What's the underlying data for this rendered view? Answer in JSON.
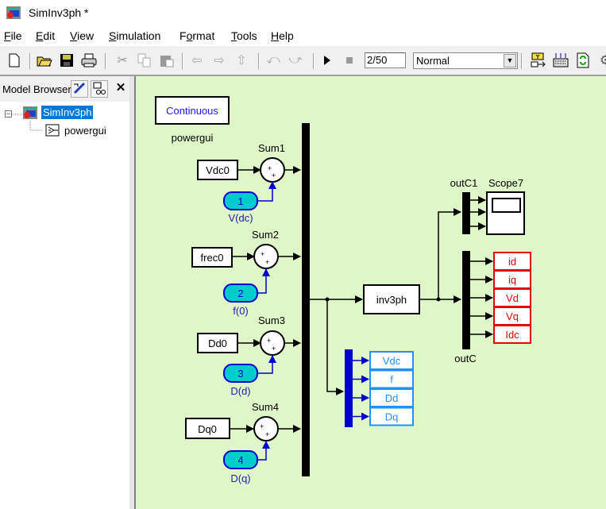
{
  "window": {
    "title": "SimInv3ph *",
    "app_icon": "simulink-model-icon"
  },
  "menu": {
    "items": [
      {
        "label": "File",
        "accel": "F"
      },
      {
        "label": "Edit",
        "accel": "E"
      },
      {
        "label": "View",
        "accel": "V"
      },
      {
        "label": "Simulation",
        "accel": "S"
      },
      {
        "label": "Format",
        "accel": "o"
      },
      {
        "label": "Tools",
        "accel": "T"
      },
      {
        "label": "Help",
        "accel": "H"
      }
    ]
  },
  "toolbar": {
    "buttons": [
      "new-icon",
      "open-icon",
      "save-icon",
      "print-icon",
      "cut-icon",
      "copy-icon",
      "paste-icon",
      "back-icon",
      "forward-icon",
      "up-icon",
      "undo-icon",
      "redo-icon",
      "run-icon",
      "stop-icon"
    ],
    "stop_time": "2/50",
    "sim_mode": "Normal",
    "right_buttons": [
      "library-browser-icon",
      "model-explorer-icon",
      "update-diagram-icon",
      "debug-icon"
    ]
  },
  "model_browser": {
    "title": "Model Browser",
    "buttons": [
      "show-library-links-icon",
      "show-masked-subsystems-icon",
      "close-icon"
    ],
    "tree": {
      "root": "SimInv3ph",
      "children": [
        "powergui"
      ]
    }
  },
  "diagram": {
    "powergui": {
      "mode": "Continuous",
      "name": "powergui"
    },
    "sums": [
      {
        "name": "Sum1",
        "const": "Vdc0",
        "inport_num": "1",
        "inport_name": "V(dc)"
      },
      {
        "name": "Sum2",
        "const": "frec0",
        "inport_num": "2",
        "inport_name": "f(0)"
      },
      {
        "name": "Sum3",
        "const": "Dd0",
        "inport_num": "3",
        "inport_name": "D(d)"
      },
      {
        "name": "Sum4",
        "const": "Dq0",
        "inport_num": "4",
        "inport_name": "D(q)"
      }
    ],
    "subsystem": "inv3ph",
    "demux_top": "outC1",
    "scope": "Scope7",
    "demux_out": "outC",
    "outports": [
      "id",
      "iq",
      "Vd",
      "Vq",
      "Idc"
    ],
    "gotos": [
      "Vdc",
      "f",
      "Dd",
      "Dq"
    ],
    "colors": {
      "background": "#dff6c8",
      "inport_fill": "#00cccc",
      "inport_stroke": "#0000cc",
      "outport": "#e60000",
      "goto": "#1e90ff",
      "bus_blue": "#0000cc"
    }
  }
}
